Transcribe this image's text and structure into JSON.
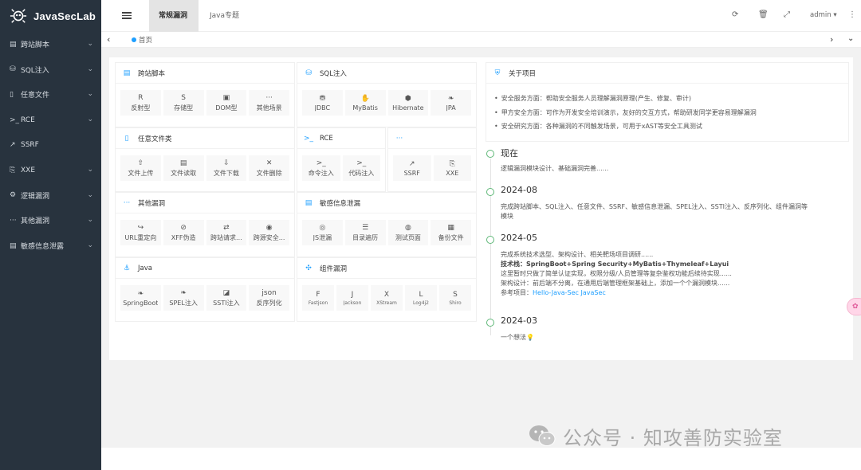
{
  "app": {
    "title": "JavaSecLab"
  },
  "sidebar": {
    "items": [
      {
        "icon": "▤",
        "label": "跨站脚本"
      },
      {
        "icon": "⛁",
        "label": "SQL注入"
      },
      {
        "icon": "▯",
        "label": "任意文件"
      },
      {
        "icon": ">_",
        "label": "RCE"
      },
      {
        "icon": "↗",
        "label": "SSRF"
      },
      {
        "icon": "⎘",
        "label": "XXE"
      },
      {
        "icon": "⚙",
        "label": "逻辑漏洞"
      },
      {
        "icon": "···",
        "label": "其他漏洞"
      },
      {
        "icon": "▤",
        "label": "敏感信息泄露"
      }
    ]
  },
  "header": {
    "tabs": [
      {
        "label": "常规漏洞"
      },
      {
        "label": "Java专题"
      }
    ],
    "user": "admin"
  },
  "breadcrumb": {
    "label": "首页"
  },
  "cards": [
    {
      "title": "跨站脚本",
      "icon": "▤",
      "items": [
        {
          "icon": "R",
          "label": "反射型"
        },
        {
          "icon": "S",
          "label": "存储型"
        },
        {
          "icon": "▣",
          "label": "DOM型"
        },
        {
          "icon": "···",
          "label": "其他场景"
        }
      ]
    },
    {
      "title": "SQL注入",
      "icon": "⛁",
      "items": [
        {
          "icon": "⛃",
          "label": "JDBC"
        },
        {
          "icon": "✋",
          "label": "MyBatis"
        },
        {
          "icon": "⬢",
          "label": "Hibernate"
        },
        {
          "icon": "❧",
          "label": "JPA"
        }
      ]
    },
    {
      "title": "任意文件类",
      "icon": "▯",
      "items": [
        {
          "icon": "⇧",
          "label": "文件上传"
        },
        {
          "icon": "▤",
          "label": "文件读取"
        },
        {
          "icon": "⇩",
          "label": "文件下载"
        },
        {
          "icon": "✕",
          "label": "文件删除"
        }
      ]
    },
    {
      "title": "RCE",
      "icon": ">_",
      "items": [
        {
          "icon": ">_",
          "label": "命令注入"
        },
        {
          "icon": ">_",
          "label": "代码注入"
        }
      ]
    },
    {
      "title": "",
      "icon": "···",
      "items": [
        {
          "icon": "↗",
          "label": "SSRF"
        },
        {
          "icon": "⎘",
          "label": "XXE"
        }
      ]
    },
    {
      "title": "其他漏洞",
      "icon": "···",
      "items": [
        {
          "icon": "↪",
          "label": "URL重定向"
        },
        {
          "icon": "⊘",
          "label": "XFF伪造"
        },
        {
          "icon": "⇄",
          "label": "跨站请求..."
        },
        {
          "icon": "◉",
          "label": "跨源安全..."
        }
      ]
    },
    {
      "title": "敏感信息泄漏",
      "icon": "▤",
      "items": [
        {
          "icon": "◎",
          "label": "JS泄漏"
        },
        {
          "icon": "☰",
          "label": "目录遍历"
        },
        {
          "icon": "◍",
          "label": "测试页面"
        },
        {
          "icon": "▦",
          "label": "备份文件"
        }
      ]
    },
    {
      "title": "Java",
      "icon": "⚓",
      "items": [
        {
          "icon": "❧",
          "label": "SpringBoot"
        },
        {
          "icon": "❧",
          "label": "SPEL注入"
        },
        {
          "icon": "◪",
          "label": "SSTI注入"
        },
        {
          "icon": "json",
          "label": "反序列化"
        }
      ]
    },
    {
      "title": "组件漏洞",
      "icon": "✣",
      "items": [
        {
          "icon": "F",
          "label": "Fastjson"
        },
        {
          "icon": "J",
          "label": "Jackson"
        },
        {
          "icon": "X",
          "label": "XStream"
        },
        {
          "icon": "L",
          "label": "Log4j2"
        },
        {
          "icon": "S",
          "label": "Shiro"
        }
      ]
    }
  ],
  "about": {
    "title": "关于项目",
    "lines": [
      "安全服务方面：帮助安全服务人员理解漏洞原理(产生、修复、审计)",
      "甲方安全方面：可作为开发安全培训演示，友好的交互方式，帮助研发同学更容易理解漏洞",
      "安全研究方面：各种漏洞的不同触发场景，可用于xAST等安全工具测试"
    ]
  },
  "timeline": [
    {
      "date": "现在",
      "lines": [
        "逻辑漏洞模块设计、基础漏洞完善......"
      ]
    },
    {
      "date": "2024-08",
      "lines": [
        "完成跨站脚本、SQL注入、任意文件、SSRF、敏感信息泄漏、SPEL注入、SSTI注入、反序列化、组件漏洞等",
        "模块"
      ]
    },
    {
      "date": "2024-05",
      "lines": [
        "完成系统技术选型、架构设计、相关靶场项目调研......",
        "技术栈：SpringBoot+Spring Security+MyBatis+Thymeleaf+Layui",
        "这里暂时只做了简单认证实现，权限分级/人员管理等复杂鉴权功能后续待实现......",
        "架构设计：前后端不分离，在通用后端管理框架基础上，添加一个个漏洞模块......",
        "参考项目："
      ],
      "link": "Hello-Java-Sec JavaSec"
    },
    {
      "date": "2024-03",
      "lines": [
        "一个想法💡"
      ]
    }
  ],
  "watermark": "公众号 · 知攻善防实验室"
}
